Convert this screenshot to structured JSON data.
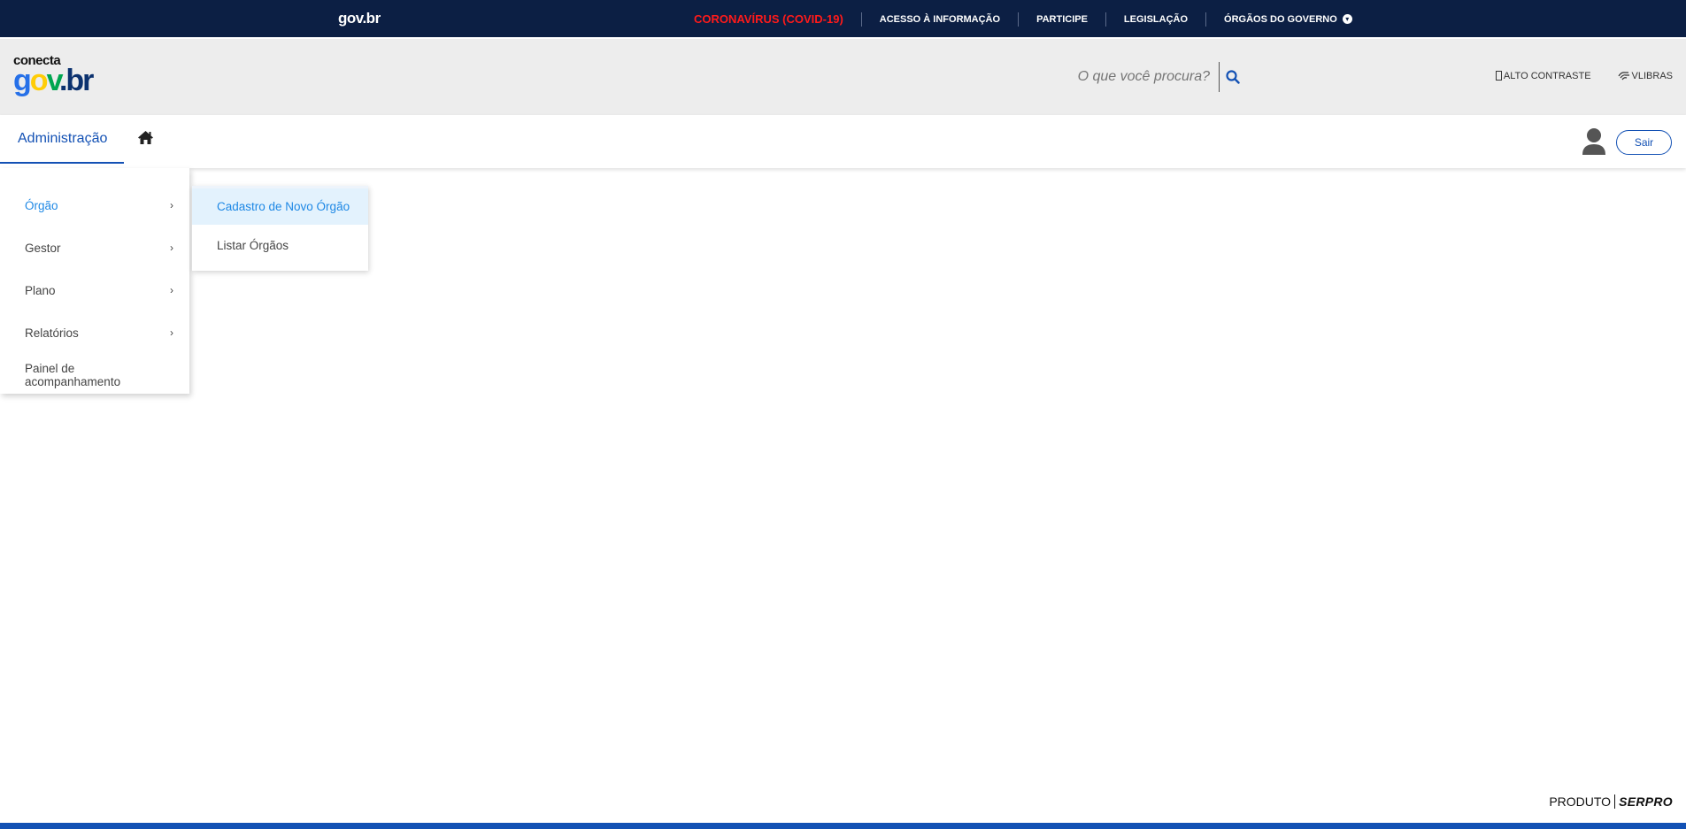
{
  "govbar": {
    "logo": "gov.br",
    "links": [
      {
        "label": "CORONAVÍRUS (COVID-19)"
      },
      {
        "label": "ACESSO À INFORMAÇÃO"
      },
      {
        "label": "PARTICIPE"
      },
      {
        "label": "LEGISLAÇÃO"
      },
      {
        "label": "ÓRGÃOS DO GOVERNO"
      }
    ],
    "covid_color": "#ff1a1a",
    "background": "#0c1f44"
  },
  "header": {
    "brand_top": "conecta",
    "brand_main": [
      "g",
      "o",
      "v",
      ".br"
    ],
    "search_placeholder": "O que você procura?",
    "search_icon": "search-icon",
    "tools": {
      "contrast": "ALTO CONTRASTE",
      "libras": "VLIBRAS"
    }
  },
  "navbar": {
    "active_tab": "Administração",
    "home_icon": "home-icon",
    "logout": "Sair",
    "accent": "#1351b4"
  },
  "menu": {
    "items": [
      {
        "label": "Órgão",
        "has_submenu": true
      },
      {
        "label": "Gestor",
        "has_submenu": true
      },
      {
        "label": "Plano",
        "has_submenu": true
      },
      {
        "label": "Relatórios",
        "has_submenu": true
      },
      {
        "label": "Painel de acompanhamento",
        "has_submenu": false
      }
    ],
    "active_color": "#1e88e5",
    "chevron": "›"
  },
  "submenu": {
    "items": [
      {
        "label": "Cadastro de Novo Órgão"
      },
      {
        "label": "Listar Órgãos"
      }
    ]
  },
  "footer": {
    "product": "PRODUTO",
    "company": "SERPRO"
  }
}
